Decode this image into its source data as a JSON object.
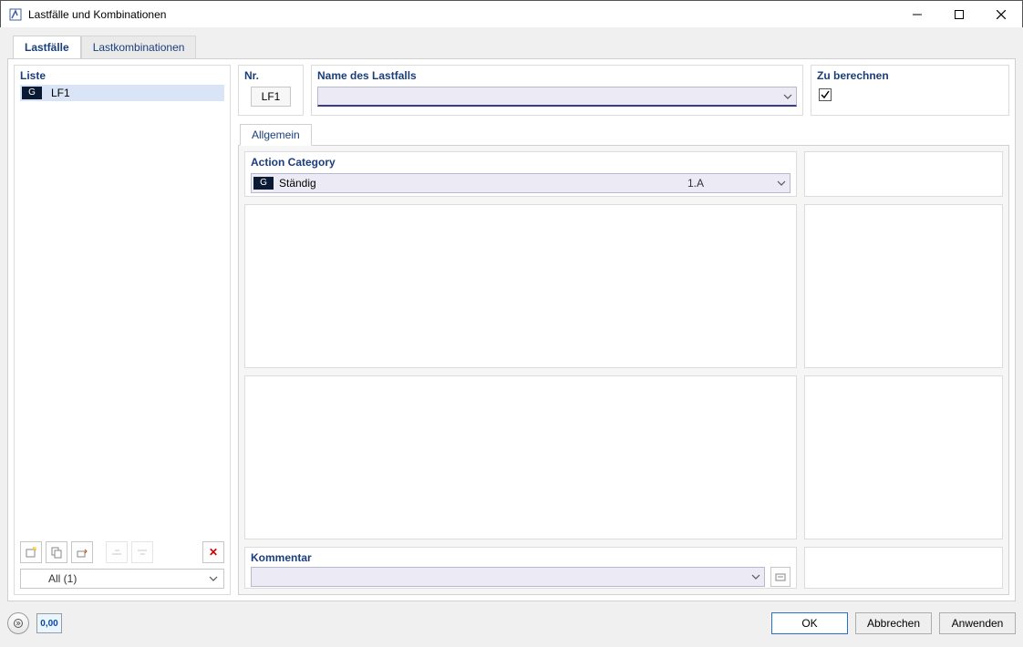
{
  "window": {
    "title": "Lastfälle und Kombinationen"
  },
  "tabs": {
    "loadcases": "Lastfälle",
    "combinations": "Lastkombinationen"
  },
  "left": {
    "heading": "Liste",
    "items": [
      {
        "badge": "G",
        "label": "LF1"
      }
    ],
    "filter": "All (1)"
  },
  "header": {
    "nr_label": "Nr.",
    "nr_value": "LF1",
    "name_label": "Name des Lastfalls",
    "name_value": "",
    "calc_label": "Zu berechnen",
    "calc_checked": true
  },
  "subtab": {
    "general": "Allgemein"
  },
  "action_category": {
    "label": "Action Category",
    "badge": "G",
    "name": "Ständig",
    "code": "1.A"
  },
  "comment": {
    "label": "Kommentar",
    "value": ""
  },
  "buttons": {
    "ok": "OK",
    "cancel": "Abbrechen",
    "apply": "Anwenden"
  },
  "icons": {
    "units": "0,00"
  }
}
